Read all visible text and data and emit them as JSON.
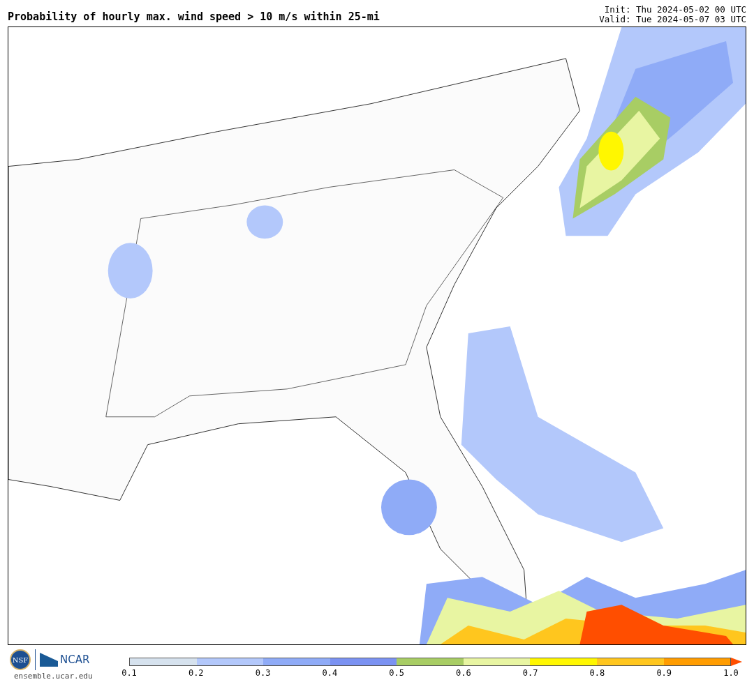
{
  "header": {
    "title": "Probability of hourly max. wind speed > 10 m/s within 25-mi",
    "init": "Init: Thu 2024-05-02 00 UTC",
    "valid": "Valid: Tue 2024-05-07 03 UTC"
  },
  "footer": {
    "logo_nsf": "NSF",
    "logo_ncar": "NCAR",
    "site": "ensemble.ucar.edu"
  },
  "colorbar": {
    "segments": [
      {
        "color": "#d6e2ee"
      },
      {
        "color": "#b3c8fb"
      },
      {
        "color": "#8fabf7"
      },
      {
        "color": "#7b92f2"
      },
      {
        "color": "#a8cd64"
      },
      {
        "color": "#e8f5a2"
      },
      {
        "color": "#fff700"
      },
      {
        "color": "#ffc61e"
      },
      {
        "color": "#ff9c00"
      }
    ],
    "extension": {
      "color": "#ff4e00"
    },
    "ticks": [
      "0.1",
      "0.2",
      "0.3",
      "0.4",
      "0.5",
      "0.6",
      "0.7",
      "0.8",
      "0.9",
      "1.0"
    ]
  }
}
